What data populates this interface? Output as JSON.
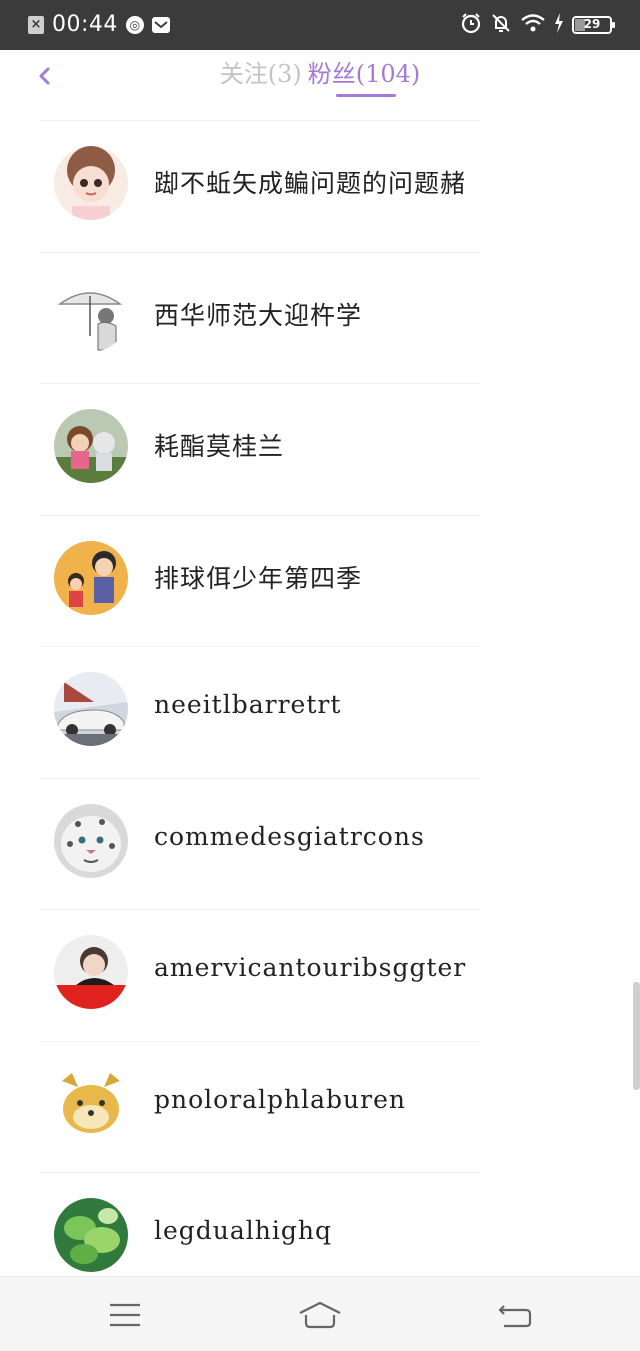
{
  "status_bar": {
    "time": "00:44",
    "battery_level": "29",
    "icons": [
      "notification-close-icon",
      "app-icon",
      "mail-icon",
      "alarm-icon",
      "mute-bell-icon",
      "wifi-icon",
      "charging-icon",
      "battery-icon"
    ]
  },
  "header": {
    "back_icon": "chevron-left-icon",
    "tabs": [
      {
        "label": "关注",
        "count": "(3)",
        "active": false
      },
      {
        "label": "粉丝",
        "count": "(104)",
        "active": true
      }
    ],
    "accent_color": "#a679d9"
  },
  "fans": [
    {
      "name": "踋不蚯矢成鳊问题的问题赭"
    },
    {
      "name": "西华师范大迎杵学"
    },
    {
      "name": "耗酯莫桂兰"
    },
    {
      "name": "排球佴少年第四季"
    },
    {
      "name": "neeitlbarretrt"
    },
    {
      "name": "commedesgiatrcons"
    },
    {
      "name": "amervicantouribsggter"
    },
    {
      "name": "pnoloralphlaburen"
    },
    {
      "name": "legdualhighq"
    }
  ],
  "nav_bar": {
    "icons": [
      "menu-icon",
      "home-icon",
      "back-icon"
    ]
  }
}
